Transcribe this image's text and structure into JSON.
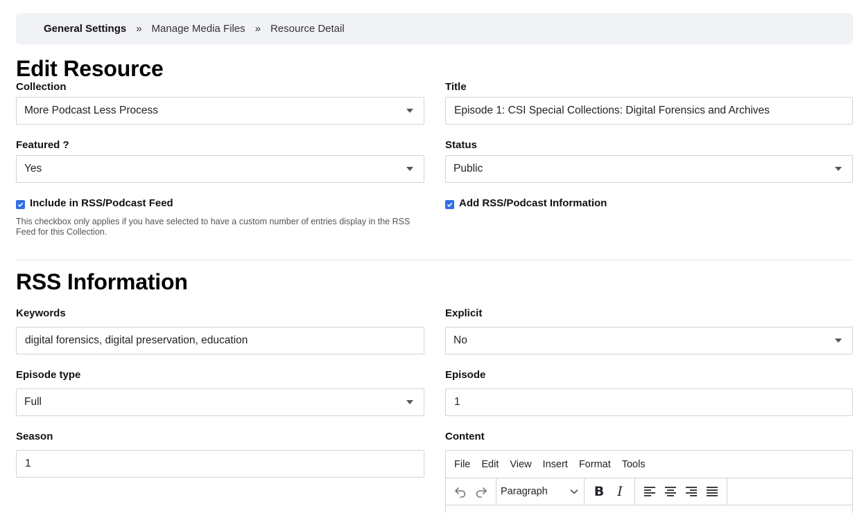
{
  "breadcrumb": {
    "home": "General Settings",
    "sep1": "»",
    "middle": "Manage Media Files",
    "sep2": "»",
    "current": "Resource Detail"
  },
  "edit_resource": {
    "heading": "Edit Resource",
    "collection": {
      "label": "Collection",
      "value": "More Podcast Less Process"
    },
    "title": {
      "label": "Title",
      "value": "Episode 1: CSI Special Collections: Digital Forensics and Archives"
    },
    "featured": {
      "label": "Featured ?",
      "value": "Yes"
    },
    "status": {
      "label": "Status",
      "value": "Public"
    },
    "include_rss": {
      "label": "Include in RSS/Podcast Feed",
      "checked": true
    },
    "include_rss_help": "This checkbox only applies if you have selected to have a custom number of entries display in the RSS Feed for this Collection.",
    "add_rss": {
      "label": "Add RSS/Podcast Information",
      "checked": true
    }
  },
  "rss_information": {
    "heading": "RSS Information",
    "keywords": {
      "label": "Keywords",
      "value": "digital forensics, digital preservation, education"
    },
    "explicit": {
      "label": "Explicit",
      "value": "No"
    },
    "episode_type": {
      "label": "Episode type",
      "value": "Full"
    },
    "episode": {
      "label": "Episode",
      "value": "1"
    },
    "season": {
      "label": "Season",
      "value": "1"
    },
    "content": {
      "label": "Content"
    }
  },
  "editor": {
    "menu": [
      "File",
      "Edit",
      "View",
      "Insert",
      "Format",
      "Tools"
    ],
    "block_format": "Paragraph",
    "bold_glyph": "B",
    "italic_glyph": "I"
  },
  "colors": {
    "checkbox": "#2f6fe4",
    "breadcrumb_bg": "#f0f2f5",
    "border": "#ced4da"
  },
  "icons": [
    "chevron-down-icon",
    "checkmark-icon",
    "undo-icon",
    "redo-icon",
    "align-left-icon",
    "align-center-icon",
    "align-right-icon",
    "align-justify-icon"
  ]
}
